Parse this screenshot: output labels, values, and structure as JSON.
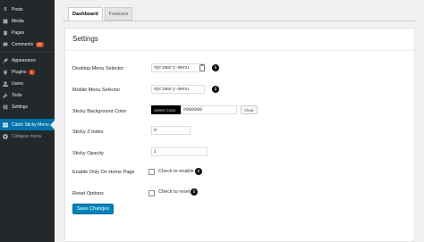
{
  "sidebar": {
    "items": [
      {
        "label": "Posts",
        "icon": "pin-icon"
      },
      {
        "label": "Media",
        "icon": "media-icon"
      },
      {
        "label": "Pages",
        "icon": "pages-icon"
      },
      {
        "label": "Comments",
        "icon": "comments-icon",
        "badge": "62"
      },
      {
        "label": "Appearance",
        "icon": "brush-icon"
      },
      {
        "label": "Plugins",
        "icon": "plugin-icon",
        "badge": "1"
      },
      {
        "label": "Users",
        "icon": "users-icon"
      },
      {
        "label": "Tools",
        "icon": "wrench-icon"
      },
      {
        "label": "Settings",
        "icon": "settings-icon"
      },
      {
        "label": "Catch Sticky Menu",
        "icon": "menu-icon",
        "active": true
      },
      {
        "label": "Collapse menu",
        "icon": "collapse-icon"
      }
    ]
  },
  "tabs": {
    "dashboard": "Dashboard",
    "features": "Features"
  },
  "panel": {
    "title": "Settings",
    "desktop_label": "Desktop Menu Selector",
    "desktop_value": "#primary-menu",
    "mobile_label": "Mobile Menu Selector",
    "mobile_value": "#primary-menu",
    "bg_label": "Sticky Background Color",
    "select_color": "Select Color",
    "bg_value": "#000000",
    "clear": "Clear",
    "zindex_label": "Sticky Z Index",
    "zindex_value": "9",
    "opacity_label": "Sticky Opacity",
    "opacity_value": "1",
    "home_label": "Enable Only On Home Page",
    "home_check": "Check to enable",
    "reset_label": "Reset Options",
    "reset_check": "Check to reset",
    "save": "Save Changes"
  },
  "colors": {
    "sidebar_bg": "#23282d",
    "active_bg": "#0073aa",
    "primary_button": "#0085ba",
    "badge": "#d54e21"
  }
}
